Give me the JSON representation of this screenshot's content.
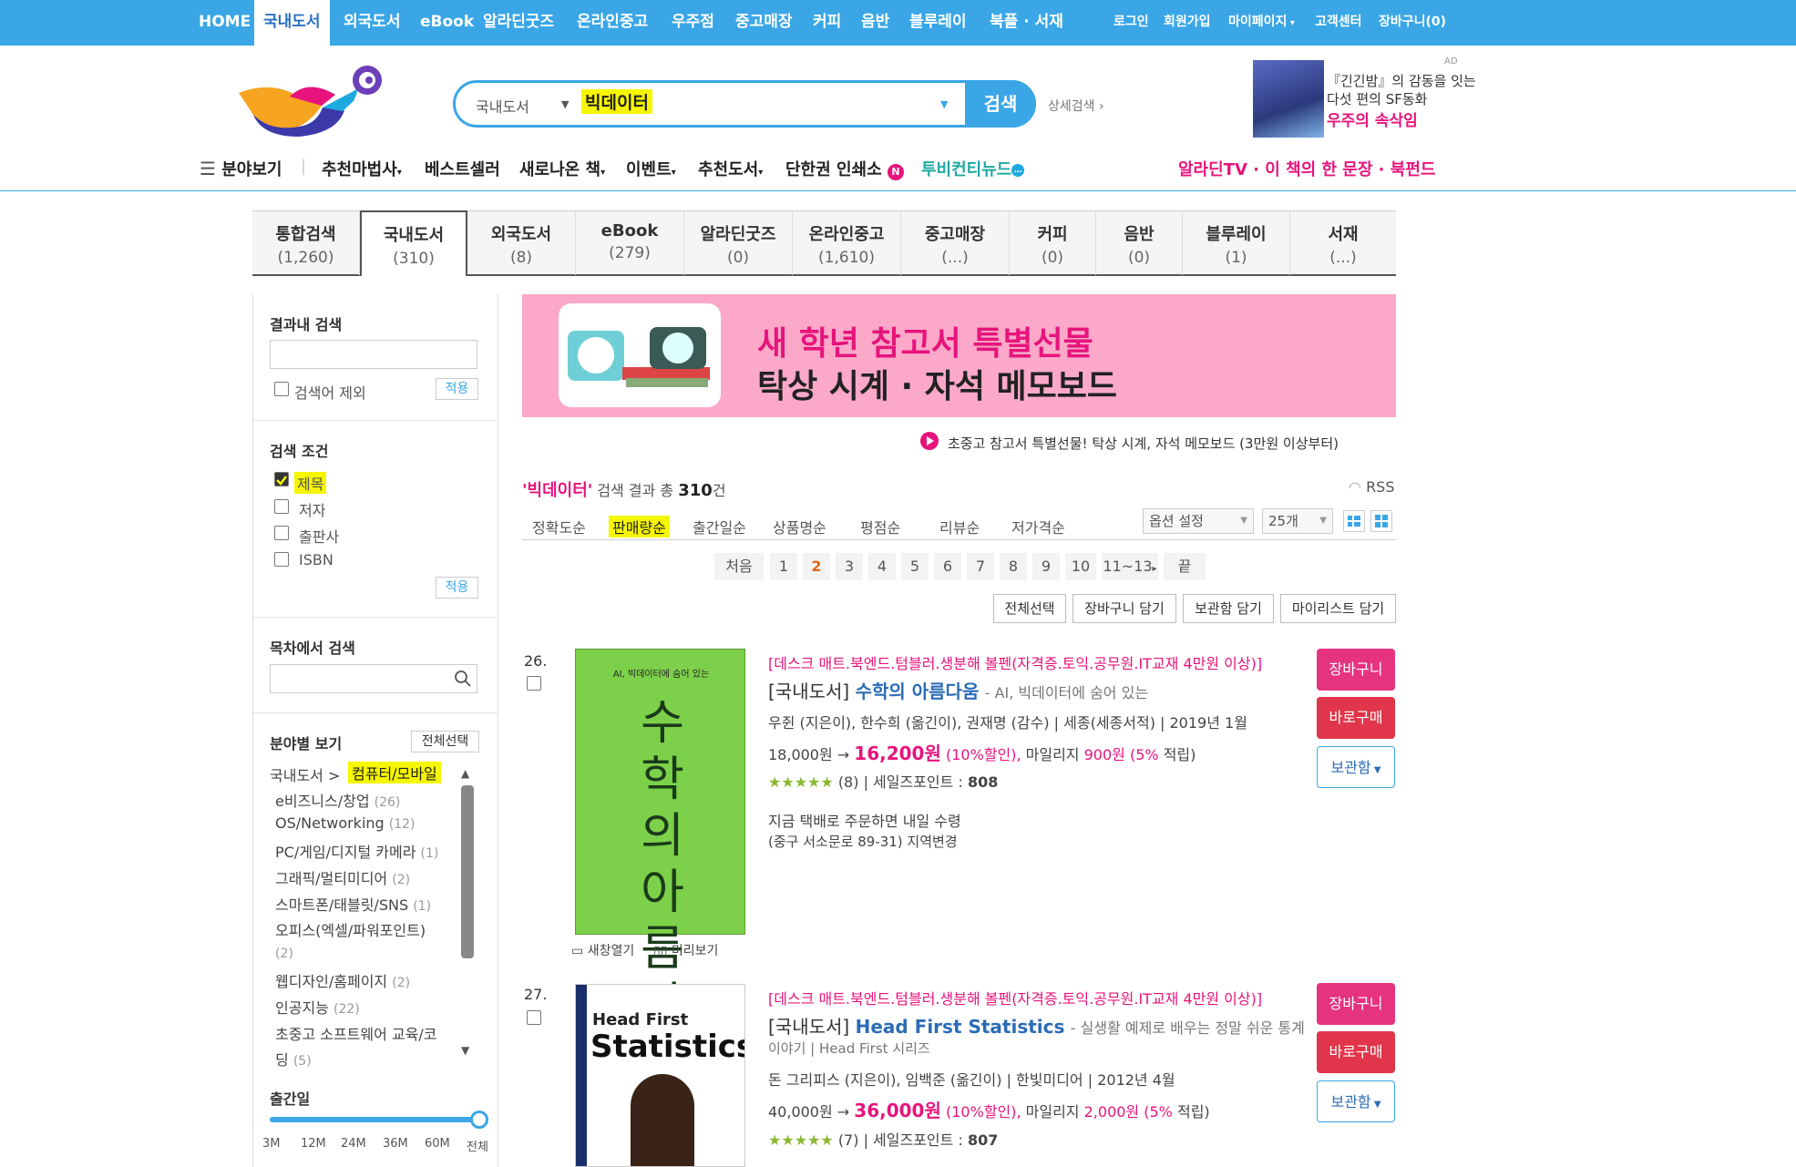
{
  "topnav": {
    "items": [
      "HOME",
      "국내도서",
      "외국도서",
      "eBook",
      "알라딘굿즈",
      "온라인중고",
      "우주점",
      "중고매장",
      "커피",
      "음반",
      "블루레이",
      "북플 · 서재"
    ],
    "right": [
      "로그인",
      "회원가입",
      "마이페이지",
      "고객센터",
      "장바구니(0)"
    ]
  },
  "search": {
    "category": "국내도서",
    "query": "빅데이터",
    "button": "검색",
    "advanced": "상세검색"
  },
  "ad": {
    "label": "AD",
    "line1": "『긴긴밤』의 감동을 잇는",
    "line2": "다섯 편의 SF동화",
    "line3": "우주의 속삭임"
  },
  "nav2": {
    "items": [
      "분야보기",
      "추천마법사",
      "베스트셀러",
      "새로나온 책",
      "이벤트",
      "추천도서",
      "단한권 인쇄소",
      "투비컨티뉴드"
    ],
    "badge": "N",
    "right": "알라딘TV · 이 책의 한 문장 · 북펀드"
  },
  "tabs": [
    {
      "label": "통합검색",
      "count": "(1,260)"
    },
    {
      "label": "국내도서",
      "count": "(310)"
    },
    {
      "label": "외국도서",
      "count": "(8)"
    },
    {
      "label": "eBook",
      "count": "(279)"
    },
    {
      "label": "알라딘굿즈",
      "count": "(0)"
    },
    {
      "label": "온라인중고",
      "count": "(1,610)"
    },
    {
      "label": "중고매장",
      "count": "(...)"
    },
    {
      "label": "커피",
      "count": "(0)"
    },
    {
      "label": "음반",
      "count": "(0)"
    },
    {
      "label": "블루레이",
      "count": "(1)"
    },
    {
      "label": "서재",
      "count": "(...)"
    }
  ],
  "sidebar": {
    "in_result": "결과내 검색",
    "exclude": "검색어 제외",
    "apply": "적용",
    "conditions": "검색 조건",
    "cond_items": [
      "제목",
      "저자",
      "출판사",
      "ISBN"
    ],
    "toc": "목차에서 검색",
    "by_field": "분야별 보기",
    "select_all": "전체선택",
    "path1": "국내도서 >",
    "path2": "컴퓨터/모바일",
    "cats": [
      [
        "e비즈니스/창업",
        "(26)"
      ],
      [
        "OS/Networking",
        "(12)"
      ],
      [
        "PC/게임/디지털 카메라",
        "(1)"
      ],
      [
        "그래픽/멀티미디어",
        "(2)"
      ],
      [
        "스마트폰/태블릿/SNS",
        "(1)"
      ],
      [
        "오피스(엑셀/파워포인트)",
        ""
      ],
      [
        "",
        "(2)"
      ],
      [
        "웹디자인/홈페이지",
        "(2)"
      ],
      [
        "인공지능",
        "(22)"
      ],
      [
        "초중고 소프트웨어 교육/코",
        ""
      ],
      [
        "딩",
        "(5)"
      ]
    ],
    "pubdate": "출간일",
    "ticks": [
      "3M",
      "12M",
      "24M",
      "36M",
      "60M",
      "전체"
    ]
  },
  "banner": {
    "line1": "새 학년 참고서 특별선물",
    "line2": "탁상 시계 · 자석 메모보드",
    "promo": "초중고 참고서 특별선물! 탁상 시계, 자석 메모보드 (3만원 이상부터)"
  },
  "result": {
    "query": "'빅데이터'",
    "text": "검색 결과 총",
    "count": "310",
    "unit": "건",
    "rss": "RSS"
  },
  "sorts": [
    "정확도순",
    "판매량순",
    "출간일순",
    "상품명순",
    "평점순",
    "리뷰순",
    "저가격순"
  ],
  "options": {
    "label": "옵션 설정",
    "per_page": "25개"
  },
  "pages": [
    "처음",
    "1",
    "2",
    "3",
    "4",
    "5",
    "6",
    "7",
    "8",
    "9",
    "10",
    "11~13",
    "끝"
  ],
  "actions": [
    "전체선택",
    "장바구니 담기",
    "보관함 담기",
    "마이리스트 담기"
  ],
  "books": [
    {
      "num": "26.",
      "promo": "[데스크 매트.북엔드.텀블러.생분해 볼펜(자격증.토익.공무원.IT교재 4만원 이상)]",
      "prefix": "[국내도서]",
      "title": "수학의 아름다움",
      "subtitle": "- AI, 빅데이터에 숨어 있는",
      "authors": "우쥔 (지은이), 한수희 (옮긴이), 권재명 (감수) | 세종(세종서적) | 2019년 1월",
      "list_price": "18,000원 →",
      "price": "16,200원",
      "discount": "(10%할인),",
      "mileage_l": "마일리지",
      "mileage": "900원",
      "mileage_r": "(5%",
      "mileage_e": "적립)",
      "stars": "★★★★★",
      "reviews": "(8) | 세일즈포인트 :",
      "sales": "808",
      "delivery": "지금 택배로 주문하면 내일 수령",
      "addr": "(중구 서소문로 89-31) 지역변경",
      "new_window": "새창열기",
      "preview": "미리보기",
      "cover_top": "AI, 빅데이터에 숨어 있는",
      "cover_title": "수학의아름다움"
    },
    {
      "num": "27.",
      "promo": "[데스크 매트.북엔드.텀블러.생분해 볼펜(자격증.토익.공무원.IT교재 4만원 이상)]",
      "prefix": "[국내도서]",
      "title": "Head First Statistics",
      "subtitle": "- 실생활 예제로 배우는 정말 쉬운 통계",
      "subtitle2": "이야기 | Head First 시리즈",
      "authors": "돈 그리피스 (지은이), 임백준 (옮긴이) | 한빛미디어 | 2012년 4월",
      "list_price": "40,000원 →",
      "price": "36,000원",
      "discount": "(10%할인),",
      "mileage_l": "마일리지",
      "mileage": "2,000원",
      "mileage_r": "(5%",
      "mileage_e": "적립)",
      "stars": "★★★★★",
      "reviews": "(7) | 세일즈포인트 :",
      "sales": "807",
      "cover_top": "Head First",
      "cover_title": "Statistics"
    }
  ],
  "buttons": {
    "cart": "장바구니",
    "buy": "바로구매",
    "keep": "보관함"
  }
}
